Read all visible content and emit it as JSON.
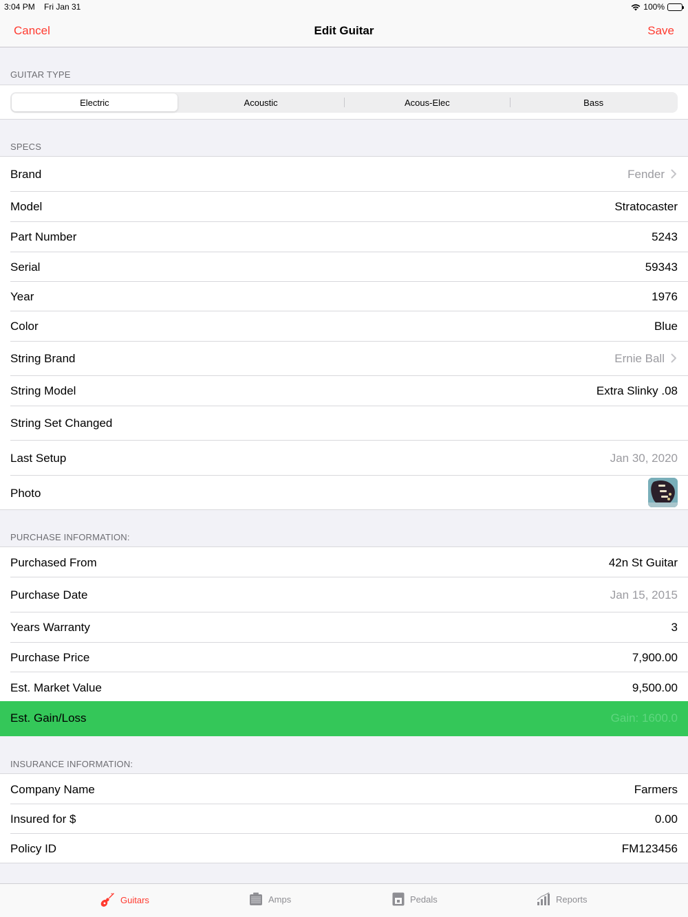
{
  "status_bar": {
    "time": "3:04 PM",
    "date": "Fri Jan 31",
    "battery": "100%"
  },
  "nav": {
    "cancel": "Cancel",
    "title": "Edit Guitar",
    "save": "Save"
  },
  "sections": {
    "guitar_type": "GUITAR TYPE",
    "specs": "SPECS",
    "purchase": "PURCHASE INFORMATION:",
    "insurance": "INSURANCE INFORMATION:"
  },
  "guitar_type": {
    "options": [
      "Electric",
      "Acoustic",
      "Acous-Elec",
      "Bass"
    ],
    "selected": "Electric"
  },
  "specs": {
    "brand": {
      "label": "Brand",
      "value": "Fender"
    },
    "model": {
      "label": "Model",
      "value": "Stratocaster"
    },
    "part_number": {
      "label": "Part Number",
      "value": "5243"
    },
    "serial": {
      "label": "Serial",
      "value": "59343"
    },
    "year": {
      "label": "Year",
      "value": "1976"
    },
    "color": {
      "label": "Color",
      "value": "Blue"
    },
    "string_brand": {
      "label": "String Brand",
      "value": "Ernie Ball"
    },
    "string_model": {
      "label": "String Model",
      "value": "Extra Slinky .08"
    },
    "string_set_changed": {
      "label": "String Set Changed",
      "value": ""
    },
    "last_setup": {
      "label": "Last Setup",
      "value": "Jan 30, 2020"
    },
    "photo": {
      "label": "Photo"
    }
  },
  "purchase": {
    "purchased_from": {
      "label": "Purchased From",
      "value": "42n St Guitar"
    },
    "purchase_date": {
      "label": "Purchase Date",
      "value": "Jan 15, 2015"
    },
    "years_warranty": {
      "label": "Years Warranty",
      "value": "3"
    },
    "purchase_price": {
      "label": "Purchase Price",
      "value": "7,900.00"
    },
    "market_value": {
      "label": "Est. Market Value",
      "value": "9,500.00"
    },
    "gain_loss": {
      "label": "Est. Gain/Loss",
      "value": "Gain: 1600.0"
    }
  },
  "insurance": {
    "company": {
      "label": "Company Name",
      "value": "Farmers"
    },
    "insured_for": {
      "label": "Insured for $",
      "value": "0.00"
    },
    "policy_id": {
      "label": "Policy ID",
      "value": "FM123456"
    }
  },
  "tabs": [
    {
      "label": "Guitars",
      "icon": "guitar-icon",
      "active": true
    },
    {
      "label": "Amps",
      "icon": "amp-icon",
      "active": false
    },
    {
      "label": "Pedals",
      "icon": "pedal-icon",
      "active": false
    },
    {
      "label": "Reports",
      "icon": "chart-bars-icon",
      "active": false
    }
  ],
  "colors": {
    "accent": "#ff3b30",
    "gain_background": "#34c759",
    "muted_text": "#9b9ba0",
    "group_background": "#f2f2f7"
  }
}
